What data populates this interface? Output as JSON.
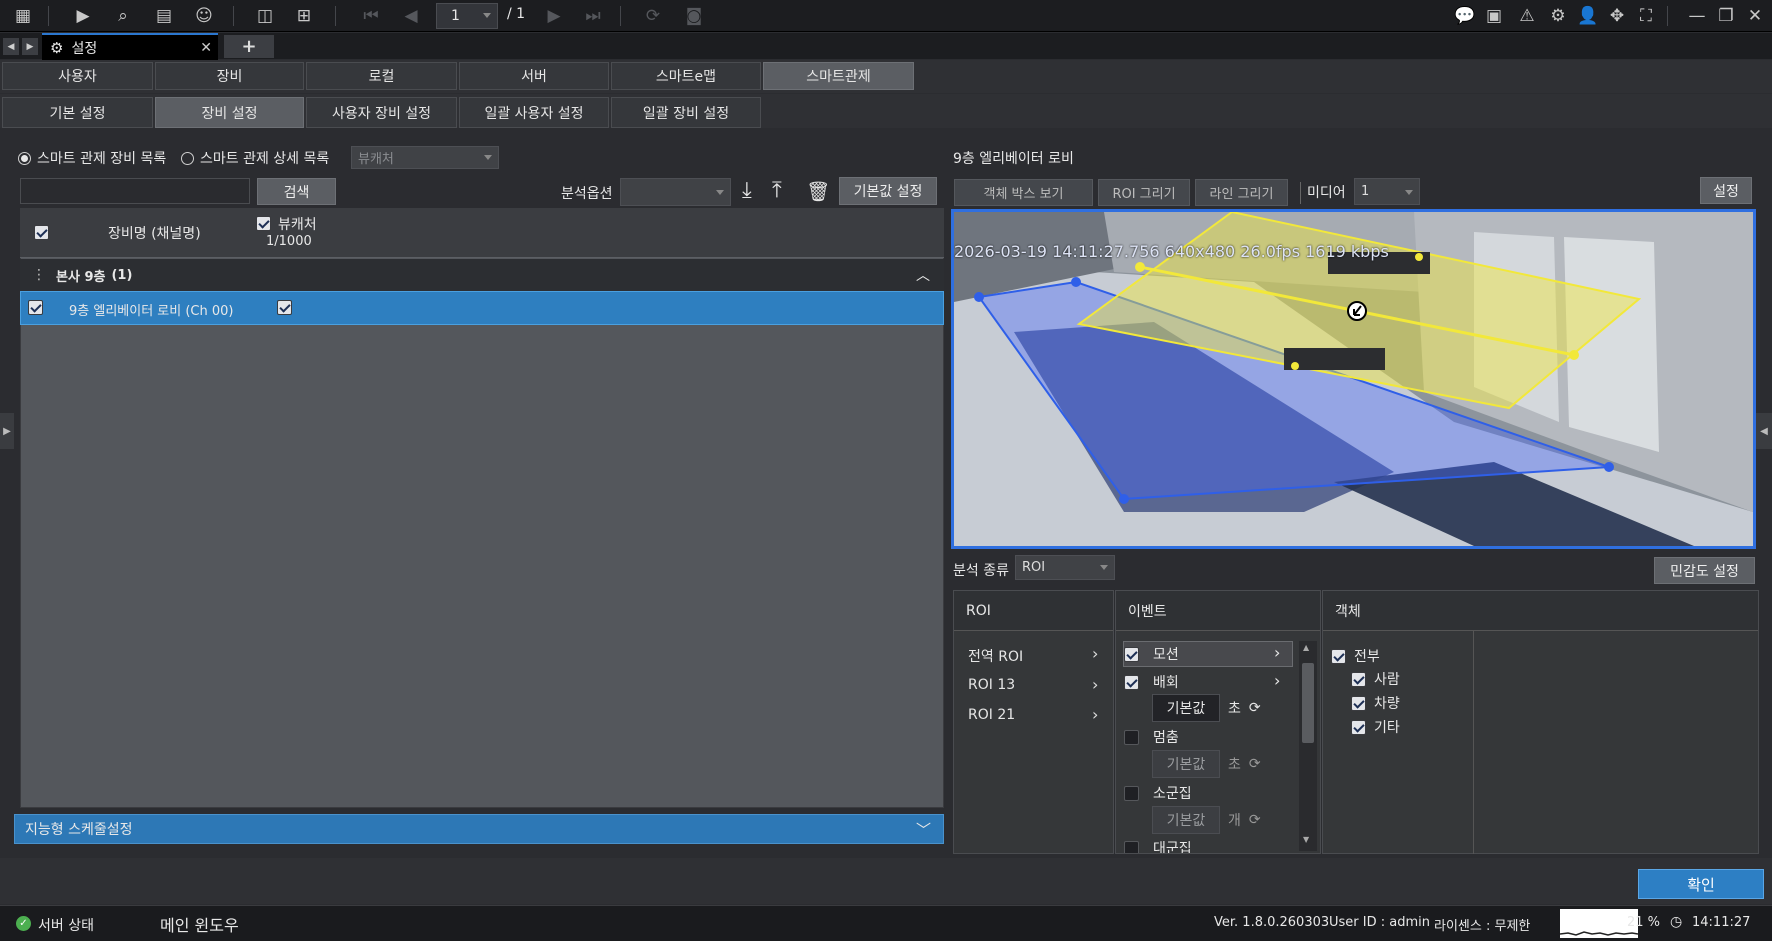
{
  "toolbar": {
    "page_current": "1",
    "page_total": "/ 1",
    "left_icons": [
      "grid-menu-icon",
      "play-video-icon",
      "search-playback-icon",
      "event-search-icon",
      "person-search-icon",
      "layout-icon",
      "add-screen-icon"
    ],
    "nav_icons": [
      "first-page-icon",
      "prev-page-icon",
      "next-page-icon",
      "last-page-icon"
    ],
    "right_icons": [
      "chat-icon",
      "remote-icon",
      "alarm-icon",
      "gear-icon",
      "user-icon",
      "move-icon",
      "fullscreen-icon",
      "minimize-icon",
      "restore-icon",
      "close-icon"
    ]
  },
  "tabs": {
    "active_label": "설정"
  },
  "menu1": [
    {
      "label": "사용자",
      "active": false
    },
    {
      "label": "장비",
      "active": false
    },
    {
      "label": "로컬",
      "active": false
    },
    {
      "label": "서버",
      "active": false
    },
    {
      "label": "스마트e맵",
      "active": false
    },
    {
      "label": "스마트관제",
      "active": true
    }
  ],
  "menu2": [
    {
      "label": "기본 설정",
      "active": false
    },
    {
      "label": "장비 설정",
      "active": true
    },
    {
      "label": "사용자 장비 설정",
      "active": false
    },
    {
      "label": "일괄 사용자 설정",
      "active": false
    },
    {
      "label": "일괄 장비 설정",
      "active": false
    }
  ],
  "left": {
    "radio_device_list": "스마트 관제 장비 목록",
    "radio_detail_list": "스마트 관제 상세 목록",
    "viewer_dd": "뷰캐처",
    "search_btn": "검색",
    "analysis_option_label": "분석옵션",
    "default_btn": "기본값 설정",
    "col_device_name": "장비명 (채널명)",
    "col_viewer": "뷰캐처",
    "col_count": "1/1000",
    "group_name": "본사 9층",
    "group_count": "(1)",
    "device_name": "9층 엘리베이터 로비 (Ch 00)",
    "schedule_label": "지능형 스케줄설정"
  },
  "right": {
    "title": "9층 엘리베이터 로비",
    "btn_object_box": "객체 박스 보기",
    "btn_roi_draw": "ROI 그리기",
    "btn_line_draw": "라인 그리기",
    "media_label": "미디어",
    "media_value": "1",
    "settings_btn": "설정",
    "osd": "2026-03-19 14:11:27.756 640x480  26.0fps 1619 kbps",
    "analysis_type_label": "분석 종류",
    "analysis_type_value": "ROI",
    "sensitivity_btn": "민감도 설정",
    "roi_header": "ROI",
    "roi_items": [
      "전역 ROI",
      "ROI 13",
      "ROI 21"
    ],
    "event_header": "이벤트",
    "events": {
      "motion": "모션",
      "loiter": "배회",
      "stop": "멈춤",
      "small_crowd": "소군집",
      "large_crowd": "대군집",
      "default": "기본값",
      "unit_sec": "초",
      "unit_count": "개"
    },
    "object_header": "객체",
    "objects": {
      "all": "전부",
      "person": "사람",
      "vehicle": "차량",
      "other": "기타"
    },
    "ok_btn": "확인"
  },
  "status": {
    "server_state": "서버 상태",
    "main_window": "메인 윈도우",
    "version": "Ver. 1.8.0.260303",
    "user_id": "User ID : admin",
    "license": "라이센스 : 무제한",
    "cpu": "21 %",
    "time": "14:11:27"
  },
  "colors": {
    "accent_blue": "#2e7fc0",
    "roi_yellow": "#f2e83a",
    "roi_blue": "#3c6cf0"
  }
}
